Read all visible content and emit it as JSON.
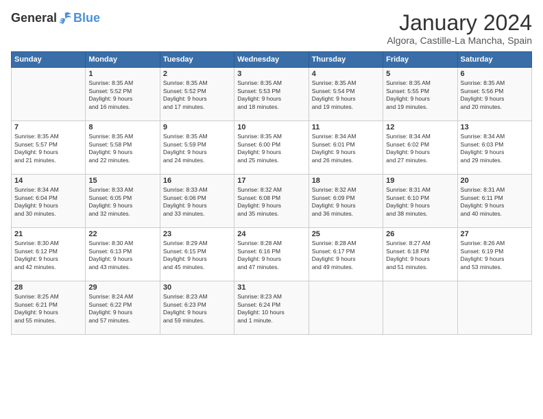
{
  "header": {
    "logo": {
      "text_general": "General",
      "text_blue": "Blue"
    },
    "title": "January 2024",
    "location": "Algora, Castille-La Mancha, Spain"
  },
  "calendar": {
    "days_of_week": [
      "Sunday",
      "Monday",
      "Tuesday",
      "Wednesday",
      "Thursday",
      "Friday",
      "Saturday"
    ],
    "weeks": [
      [
        {
          "day": "",
          "content": ""
        },
        {
          "day": "1",
          "content": "Sunrise: 8:35 AM\nSunset: 5:52 PM\nDaylight: 9 hours\nand 16 minutes."
        },
        {
          "day": "2",
          "content": "Sunrise: 8:35 AM\nSunset: 5:52 PM\nDaylight: 9 hours\nand 17 minutes."
        },
        {
          "day": "3",
          "content": "Sunrise: 8:35 AM\nSunset: 5:53 PM\nDaylight: 9 hours\nand 18 minutes."
        },
        {
          "day": "4",
          "content": "Sunrise: 8:35 AM\nSunset: 5:54 PM\nDaylight: 9 hours\nand 19 minutes."
        },
        {
          "day": "5",
          "content": "Sunrise: 8:35 AM\nSunset: 5:55 PM\nDaylight: 9 hours\nand 19 minutes."
        },
        {
          "day": "6",
          "content": "Sunrise: 8:35 AM\nSunset: 5:56 PM\nDaylight: 9 hours\nand 20 minutes."
        }
      ],
      [
        {
          "day": "7",
          "content": "Sunrise: 8:35 AM\nSunset: 5:57 PM\nDaylight: 9 hours\nand 21 minutes."
        },
        {
          "day": "8",
          "content": "Sunrise: 8:35 AM\nSunset: 5:58 PM\nDaylight: 9 hours\nand 22 minutes."
        },
        {
          "day": "9",
          "content": "Sunrise: 8:35 AM\nSunset: 5:59 PM\nDaylight: 9 hours\nand 24 minutes."
        },
        {
          "day": "10",
          "content": "Sunrise: 8:35 AM\nSunset: 6:00 PM\nDaylight: 9 hours\nand 25 minutes."
        },
        {
          "day": "11",
          "content": "Sunrise: 8:34 AM\nSunset: 6:01 PM\nDaylight: 9 hours\nand 26 minutes."
        },
        {
          "day": "12",
          "content": "Sunrise: 8:34 AM\nSunset: 6:02 PM\nDaylight: 9 hours\nand 27 minutes."
        },
        {
          "day": "13",
          "content": "Sunrise: 8:34 AM\nSunset: 6:03 PM\nDaylight: 9 hours\nand 29 minutes."
        }
      ],
      [
        {
          "day": "14",
          "content": "Sunrise: 8:34 AM\nSunset: 6:04 PM\nDaylight: 9 hours\nand 30 minutes."
        },
        {
          "day": "15",
          "content": "Sunrise: 8:33 AM\nSunset: 6:05 PM\nDaylight: 9 hours\nand 32 minutes."
        },
        {
          "day": "16",
          "content": "Sunrise: 8:33 AM\nSunset: 6:06 PM\nDaylight: 9 hours\nand 33 minutes."
        },
        {
          "day": "17",
          "content": "Sunrise: 8:32 AM\nSunset: 6:08 PM\nDaylight: 9 hours\nand 35 minutes."
        },
        {
          "day": "18",
          "content": "Sunrise: 8:32 AM\nSunset: 6:09 PM\nDaylight: 9 hours\nand 36 minutes."
        },
        {
          "day": "19",
          "content": "Sunrise: 8:31 AM\nSunset: 6:10 PM\nDaylight: 9 hours\nand 38 minutes."
        },
        {
          "day": "20",
          "content": "Sunrise: 8:31 AM\nSunset: 6:11 PM\nDaylight: 9 hours\nand 40 minutes."
        }
      ],
      [
        {
          "day": "21",
          "content": "Sunrise: 8:30 AM\nSunset: 6:12 PM\nDaylight: 9 hours\nand 42 minutes."
        },
        {
          "day": "22",
          "content": "Sunrise: 8:30 AM\nSunset: 6:13 PM\nDaylight: 9 hours\nand 43 minutes."
        },
        {
          "day": "23",
          "content": "Sunrise: 8:29 AM\nSunset: 6:15 PM\nDaylight: 9 hours\nand 45 minutes."
        },
        {
          "day": "24",
          "content": "Sunrise: 8:28 AM\nSunset: 6:16 PM\nDaylight: 9 hours\nand 47 minutes."
        },
        {
          "day": "25",
          "content": "Sunrise: 8:28 AM\nSunset: 6:17 PM\nDaylight: 9 hours\nand 49 minutes."
        },
        {
          "day": "26",
          "content": "Sunrise: 8:27 AM\nSunset: 6:18 PM\nDaylight: 9 hours\nand 51 minutes."
        },
        {
          "day": "27",
          "content": "Sunrise: 8:26 AM\nSunset: 6:19 PM\nDaylight: 9 hours\nand 53 minutes."
        }
      ],
      [
        {
          "day": "28",
          "content": "Sunrise: 8:25 AM\nSunset: 6:21 PM\nDaylight: 9 hours\nand 55 minutes."
        },
        {
          "day": "29",
          "content": "Sunrise: 8:24 AM\nSunset: 6:22 PM\nDaylight: 9 hours\nand 57 minutes."
        },
        {
          "day": "30",
          "content": "Sunrise: 8:23 AM\nSunset: 6:23 PM\nDaylight: 9 hours\nand 59 minutes."
        },
        {
          "day": "31",
          "content": "Sunrise: 8:23 AM\nSunset: 6:24 PM\nDaylight: 10 hours\nand 1 minute."
        },
        {
          "day": "",
          "content": ""
        },
        {
          "day": "",
          "content": ""
        },
        {
          "day": "",
          "content": ""
        }
      ]
    ]
  }
}
